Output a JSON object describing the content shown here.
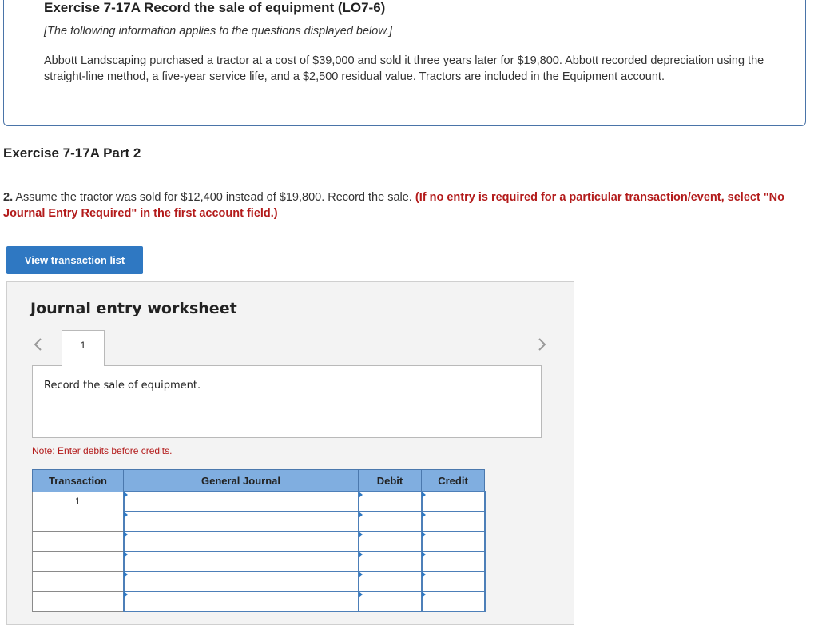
{
  "exercise": {
    "title": "Exercise 7-17A Record the sale of equipment (LO7-6)",
    "note": "[The following information applies to the questions displayed below.]",
    "paragraph": "Abbott Landscaping purchased a tractor at a cost of $39,000 and sold it three years later for $19,800. Abbott recorded depreciation using the straight-line method, a five-year service life, and a $2,500 residual value. Tractors are included in the Equipment account."
  },
  "part": {
    "title": "Exercise 7-17A Part 2",
    "question_number": "2.",
    "question_text": " Assume the tractor was sold for $12,400 instead of $19,800. Record the sale. ",
    "question_requirement": "(If no entry is required for a particular transaction/event, select \"No Journal Entry Required\" in the first account field.)"
  },
  "view_button": {
    "label": "View transaction list"
  },
  "worksheet": {
    "title": "Journal entry worksheet",
    "tabs": [
      "1"
    ],
    "description": "Record the sale of equipment.",
    "note": "Note: Enter debits before credits.",
    "columns": [
      "Transaction",
      "General Journal",
      "Debit",
      "Credit"
    ],
    "rows": [
      {
        "transaction": "1",
        "account": "",
        "debit": "",
        "credit": ""
      },
      {
        "transaction": "",
        "account": "",
        "debit": "",
        "credit": ""
      },
      {
        "transaction": "",
        "account": "",
        "debit": "",
        "credit": ""
      },
      {
        "transaction": "",
        "account": "",
        "debit": "",
        "credit": ""
      },
      {
        "transaction": "",
        "account": "",
        "debit": "",
        "credit": ""
      },
      {
        "transaction": "",
        "account": "",
        "debit": "",
        "credit": ""
      }
    ]
  },
  "colors": {
    "accent": "#2f78c2",
    "header_bg": "#80aee0",
    "requirement_red": "#b31b1b",
    "border_blue": "#4a74a8"
  },
  "icons": {
    "prev": "chevron-left-icon",
    "next": "chevron-right-icon",
    "cell_marker": "triangle-right-icon"
  }
}
